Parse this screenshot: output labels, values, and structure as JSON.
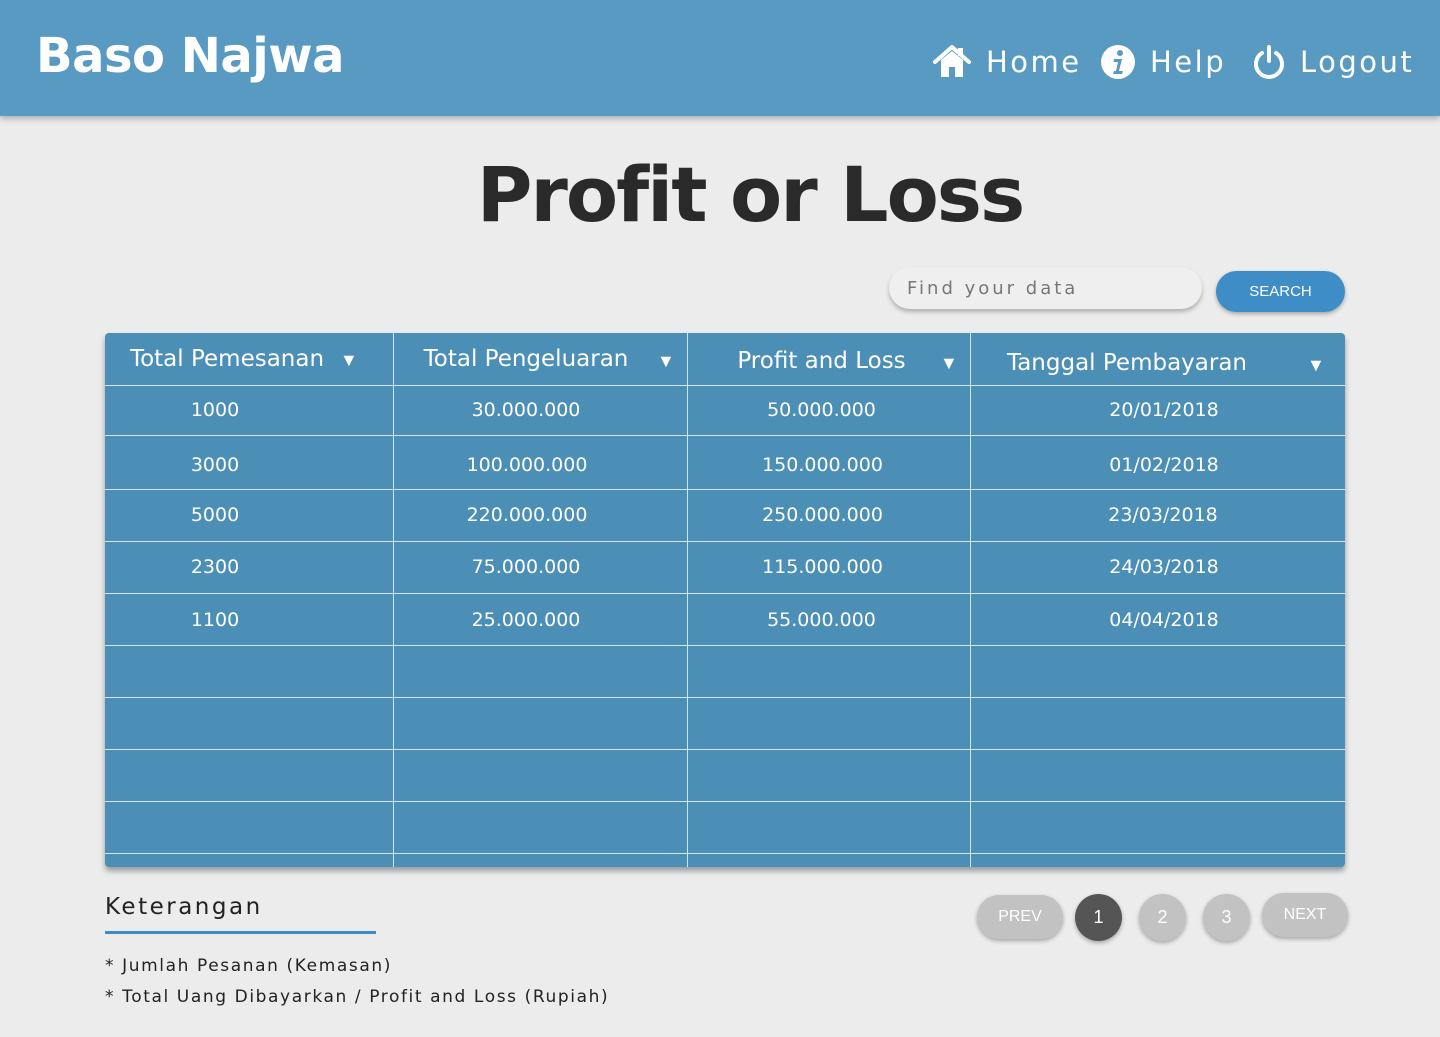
{
  "header": {
    "brand": "Baso Najwa",
    "nav": {
      "home": "Home",
      "help": "Help",
      "logout": "Logout"
    }
  },
  "page": {
    "title": "Profit or Loss"
  },
  "search": {
    "placeholder": "Find your data",
    "button": "SEARCH"
  },
  "table": {
    "columns": [
      "Total Pemesanan",
      "Total Pengeluaran",
      "Profit and Loss",
      "Tanggal Pembayaran"
    ],
    "rows": [
      [
        "1000",
        "30.000.000",
        "50.000.000",
        "20/01/2018"
      ],
      [
        "3000",
        "100.000.000",
        "150.000.000",
        "01/02/2018"
      ],
      [
        "5000",
        "220.000.000",
        "250.000.000",
        "23/03/2018"
      ],
      [
        "2300",
        "75.000.000",
        "115.000.000",
        "24/03/2018"
      ],
      [
        "1100",
        "25.000.000",
        "55.000.000",
        "04/04/2018"
      ]
    ],
    "sort_indicator": "▼"
  },
  "legend": {
    "title": "Keterangan",
    "notes": [
      "* Jumlah Pesanan (Kemasan)",
      "* Total Uang Dibayarkan / Profit and Loss (Rupiah)"
    ]
  },
  "pagination": {
    "prev": "PREV",
    "pages": [
      "1",
      "2",
      "3"
    ],
    "current": "1",
    "next": "NEXT"
  },
  "colors": {
    "header_bg": "#589ac2",
    "table_bg": "#4c8fb6",
    "accent": "#3f8dc7",
    "page_bg": "#ececec"
  }
}
